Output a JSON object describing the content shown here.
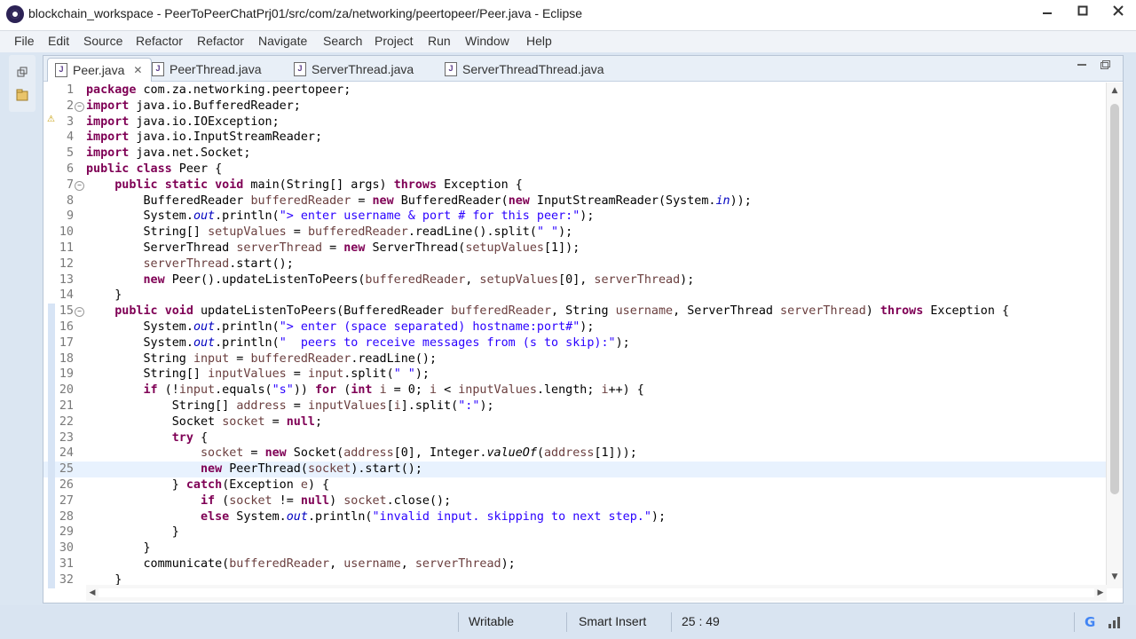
{
  "window": {
    "title": "blockchain_workspace - PeerToPeerChatPrj01/src/com/za/networking/peertopeer/Peer.java - Eclipse",
    "controls": [
      "minimize",
      "maximize",
      "close"
    ]
  },
  "menu": [
    "File",
    "Edit",
    "Source",
    "Refactor",
    "Refactor",
    "Navigate",
    "Search",
    "Project",
    "Run",
    "Window",
    "Help"
  ],
  "tabs": [
    {
      "label": "Peer.java",
      "active": true
    },
    {
      "label": "PeerThread.java",
      "active": false
    },
    {
      "label": "ServerThread.java",
      "active": false
    },
    {
      "label": "ServerThreadThread.java",
      "active": false
    }
  ],
  "code": {
    "current_line": 25,
    "lines": [
      {
        "n": "1",
        "text": "package com.za.networking.peertopeer;"
      },
      {
        "n": "2",
        "text": "import java.io.BufferedReader;"
      },
      {
        "n": "3",
        "text": "import java.io.IOException;"
      },
      {
        "n": "4",
        "text": "import java.io.InputStreamReader;"
      },
      {
        "n": "5",
        "text": "import java.net.Socket;"
      },
      {
        "n": "6",
        "text": "public class Peer {"
      },
      {
        "n": "7",
        "text": "    public static void main(String[] args) throws Exception {"
      },
      {
        "n": "8",
        "text": "        BufferedReader bufferedReader = new BufferedReader(new InputStreamReader(System.in));"
      },
      {
        "n": "9",
        "text": "        System.out.println(\"> enter username & port # for this peer:\");"
      },
      {
        "n": "10",
        "text": "        String[] setupValues = bufferedReader.readLine().split(\" \");"
      },
      {
        "n": "11",
        "text": "        ServerThread serverThread = new ServerThread(setupValues[1]);"
      },
      {
        "n": "12",
        "text": "        serverThread.start();"
      },
      {
        "n": "13",
        "text": "        new Peer().updateListenToPeers(bufferedReader, setupValues[0], serverThread);"
      },
      {
        "n": "14",
        "text": "    }"
      },
      {
        "n": "15",
        "text": "    public void updateListenToPeers(BufferedReader bufferedReader, String username, ServerThread serverThread) throws Exception {"
      },
      {
        "n": "16",
        "text": "        System.out.println(\"> enter (space separated) hostname:port#\");"
      },
      {
        "n": "17",
        "text": "        System.out.println(\"  peers to receive messages from (s to skip):\");"
      },
      {
        "n": "18",
        "text": "        String input = bufferedReader.readLine();"
      },
      {
        "n": "19",
        "text": "        String[] inputValues = input.split(\" \");"
      },
      {
        "n": "20",
        "text": "        if (!input.equals(\"s\")) for (int i = 0; i < inputValues.length; i++) {"
      },
      {
        "n": "21",
        "text": "            String[] address = inputValues[i].split(\":\");"
      },
      {
        "n": "22",
        "text": "            Socket socket = null;"
      },
      {
        "n": "23",
        "text": "            try {"
      },
      {
        "n": "24",
        "text": "                socket = new Socket(address[0], Integer.valueOf(address[1]));"
      },
      {
        "n": "25",
        "text": "                new PeerThread(socket).start();"
      },
      {
        "n": "26",
        "text": "            } catch(Exception e) {"
      },
      {
        "n": "27",
        "text": "                if (socket != null) socket.close();"
      },
      {
        "n": "28",
        "text": "                else System.out.println(\"invalid input. skipping to next step.\");"
      },
      {
        "n": "29",
        "text": "            }"
      },
      {
        "n": "30",
        "text": "        }"
      },
      {
        "n": "31",
        "text": "        communicate(bufferedReader, username, serverThread);"
      },
      {
        "n": "32",
        "text": "    }"
      }
    ]
  },
  "status": {
    "writable": "Writable",
    "insert_mode": "Smart Insert",
    "position": "25 : 49"
  }
}
